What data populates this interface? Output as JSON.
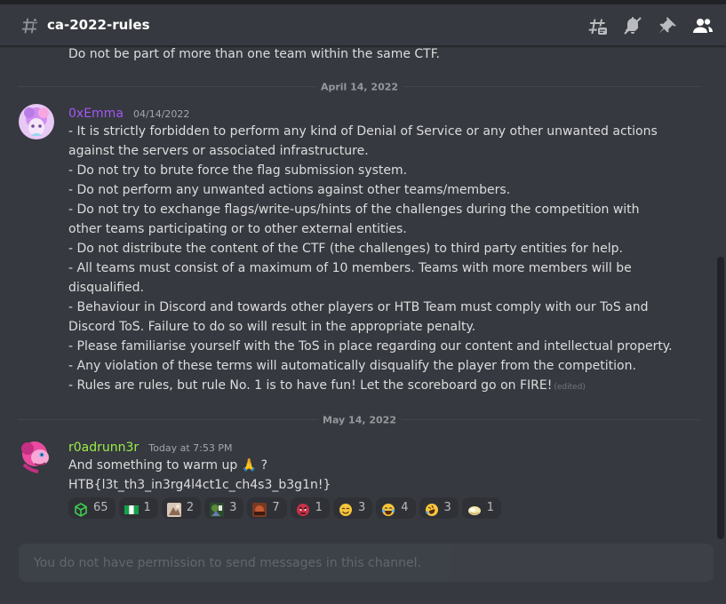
{
  "header": {
    "channel_name": "ca-2022-rules",
    "icons": [
      "threads-icon",
      "notifications-muted-icon",
      "pin-icon",
      "member-list-icon"
    ]
  },
  "messages": {
    "previous_line": "Do not be part of more than one team within the same CTF.",
    "dividers": [
      "April 14, 2022",
      "May 14, 2022"
    ],
    "rules_message": {
      "author": "0xEmma",
      "author_color": "#a358f4",
      "timestamp": "04/14/2022",
      "lines": [
        "- It is strictly forbidden to perform any kind of Denial of Service or any other unwanted actions against the servers or associated infrastructure.",
        "- Do not try to brute force the flag submission system.",
        "- Do not perform any unwanted actions against other teams/members.",
        "- Do not try to exchange flags/write-ups/hints of the challenges during the competition with other teams participating or to other external entities.",
        "- Do not distribute the content of the CTF (the challenges) to third party entities for help.",
        "- All teams must consist of a maximum of 10 members. Teams with more members will be disqualified.",
        "- Behaviour in Discord and towards other players or HTB Team must comply with our ToS and Discord ToS. Failure to do so will result in the appropriate penalty.",
        "- Please familiarise yourself with the ToS in place regarding our content and intellectual property.",
        "- Any violation of these terms will automatically disqualify the player from the competition.",
        "- Rules are rules, but rule No. 1 is to have fun! Let the scoreboard go on FIRE!"
      ],
      "edited_label": "(edited)"
    },
    "flag_message": {
      "author": "r0adrunn3r",
      "author_color": "#9aed4a",
      "timestamp": "Today at 7:53 PM",
      "line1": "And something to warm up 🙏 ?",
      "line2": "HTB{l3t_th3_in3rg4l4ct1c_ch4s3_b3g1n!}",
      "reactions": [
        {
          "emoji": "green-cube-emoji",
          "count": "65"
        },
        {
          "emoji": "flag-emoji",
          "count": "1"
        },
        {
          "emoji": "custom-emoji-1",
          "count": "2"
        },
        {
          "emoji": "custom-emoji-2",
          "count": "3"
        },
        {
          "emoji": "custom-emoji-3",
          "count": "7"
        },
        {
          "emoji": "angry-emoji",
          "count": "1"
        },
        {
          "emoji": "smiling-face-emoji",
          "count": "3"
        },
        {
          "emoji": "tears-of-joy-emoji",
          "count": "4"
        },
        {
          "emoji": "rolling-laughing-emoji",
          "count": "3"
        },
        {
          "emoji": "custom-emoji-4",
          "count": "1"
        }
      ]
    }
  },
  "composer": {
    "placeholder": "You do not have permission to send messages in this channel."
  },
  "colors": {
    "background": "#36393f",
    "text": "#dcddde",
    "muted": "#96989d"
  }
}
